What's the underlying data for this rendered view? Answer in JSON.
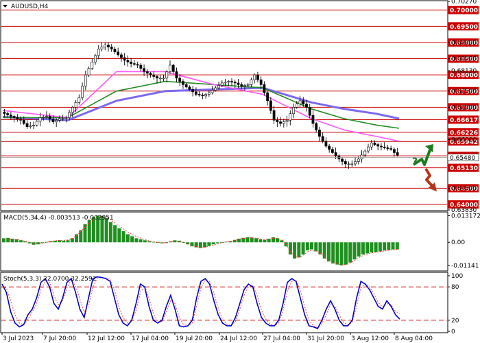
{
  "chart_data": [
    {
      "type": "candlestick",
      "title": "AUDUSD,H4",
      "ylim": [
        0.6383,
        0.7027
      ],
      "price_labels": [
        "0.70270",
        "0.69000",
        "0.68500",
        "0.68130",
        "0.67500",
        "0.67000",
        "0.66000",
        "0.64500",
        "0.63830"
      ],
      "level_lines": [
        {
          "value": 0.7,
          "label": "0.70000",
          "color": "#cc0000"
        },
        {
          "value": 0.695,
          "label": "0.69500",
          "color": "#cc0000"
        },
        {
          "value": 0.69,
          "label": "0.69000",
          "color": "#cc0000"
        },
        {
          "value": 0.685,
          "label": "0.68500",
          "color": "#cc0000"
        },
        {
          "value": 0.68,
          "label": "0.68000",
          "color": "#cc0000"
        },
        {
          "value": 0.675,
          "label": "0.67500",
          "color": "#cc0000"
        },
        {
          "value": 0.67,
          "label": "0.67000",
          "color": "#cc0000"
        },
        {
          "value": 0.66617,
          "label": "0.66617",
          "color": "#cc0000"
        },
        {
          "value": 0.66226,
          "label": "0.66226",
          "color": "#cc0000"
        },
        {
          "value": 0.65942,
          "label": "0.65942",
          "color": "#cc0000"
        },
        {
          "value": 0.655,
          "label": "0.65500",
          "color": "#cc0000"
        },
        {
          "value": 0.6513,
          "label": "0.65130",
          "color": "#cc0000"
        },
        {
          "value": 0.645,
          "label": "0.64500",
          "color": "#cc0000"
        },
        {
          "value": 0.64,
          "label": "0.64000",
          "color": "#cc0000"
        }
      ],
      "current_price": {
        "value": 0.6545,
        "label": "0.65480"
      },
      "annotation": "?",
      "x_tick_labels": [
        "3 Jul 2023",
        "7 Jul 20:00",
        "12 Jul 12:00",
        "17 Jul 04:00",
        "19 Jul 20:00",
        "24 Jul 12:00",
        "27 Jul 04:00",
        "31 Jul 20:00",
        "3 Aug 12:00",
        "8 Aug 04:00"
      ],
      "price_path": [
        [
          0,
          0.6685
        ],
        [
          3,
          0.6672
        ],
        [
          6,
          0.666
        ],
        [
          8,
          0.664
        ],
        [
          10,
          0.6645
        ],
        [
          12,
          0.6668
        ],
        [
          14,
          0.6672
        ],
        [
          16,
          0.6655
        ],
        [
          18,
          0.6665
        ],
        [
          20,
          0.6668
        ],
        [
          22,
          0.67
        ],
        [
          24,
          0.673
        ],
        [
          26,
          0.68
        ],
        [
          28,
          0.684
        ],
        [
          30,
          0.688
        ],
        [
          32,
          0.6892
        ],
        [
          34,
          0.688
        ],
        [
          36,
          0.6862
        ],
        [
          38,
          0.6845
        ],
        [
          40,
          0.6835
        ],
        [
          42,
          0.683
        ],
        [
          44,
          0.681
        ],
        [
          46,
          0.68
        ],
        [
          48,
          0.679
        ],
        [
          50,
          0.679
        ],
        [
          52,
          0.683
        ],
        [
          54,
          0.679
        ],
        [
          56,
          0.677
        ],
        [
          58,
          0.6755
        ],
        [
          60,
          0.674
        ],
        [
          62,
          0.6735
        ],
        [
          64,
          0.6745
        ],
        [
          66,
          0.676
        ],
        [
          68,
          0.6775
        ],
        [
          70,
          0.678
        ],
        [
          72,
          0.6775
        ],
        [
          74,
          0.6765
        ],
        [
          76,
          0.677
        ],
        [
          78,
          0.68
        ],
        [
          80,
          0.677
        ],
        [
          82,
          0.672
        ],
        [
          84,
          0.666
        ],
        [
          86,
          0.665
        ],
        [
          88,
          0.666
        ],
        [
          90,
          0.67
        ],
        [
          92,
          0.672
        ],
        [
          94,
          0.67
        ],
        [
          96,
          0.665
        ],
        [
          98,
          0.661
        ],
        [
          100,
          0.658
        ],
        [
          102,
          0.656
        ],
        [
          104,
          0.654
        ],
        [
          106,
          0.6525
        ],
        [
          108,
          0.6525
        ],
        [
          110,
          0.654
        ],
        [
          112,
          0.6565
        ],
        [
          114,
          0.659
        ],
        [
          116,
          0.658
        ],
        [
          118,
          0.6575
        ],
        [
          120,
          0.657
        ],
        [
          121,
          0.656
        ],
        [
          122,
          0.6552
        ]
      ],
      "series": [
        {
          "name": "",
          "color": "#7b68ee",
          "values": [
            [
              0,
              0.667
            ],
            [
              20,
              0.666
            ],
            [
              35,
              0.672
            ],
            [
              50,
              0.675
            ],
            [
              65,
              0.6755
            ],
            [
              80,
              0.676
            ],
            [
              95,
              0.6715
            ],
            [
              105,
              0.6695
            ],
            [
              115,
              0.668
            ],
            [
              122,
              0.6665
            ]
          ]
        },
        {
          "name": "",
          "color": "#228b22",
          "values": [
            [
              0,
              0.6668
            ],
            [
              20,
              0.6668
            ],
            [
              35,
              0.675
            ],
            [
              50,
              0.678
            ],
            [
              65,
              0.677
            ],
            [
              80,
              0.676
            ],
            [
              95,
              0.6695
            ],
            [
              105,
              0.6665
            ],
            [
              115,
              0.6645
            ],
            [
              122,
              0.6635
            ]
          ]
        },
        {
          "name": "",
          "color": "#ff55ff",
          "values": [
            [
              0,
              0.669
            ],
            [
              20,
              0.6668
            ],
            [
              35,
              0.681
            ],
            [
              50,
              0.681
            ],
            [
              65,
              0.677
            ],
            [
              80,
              0.674
            ],
            [
              95,
              0.6665
            ],
            [
              105,
              0.663
            ],
            [
              115,
              0.661
            ],
            [
              122,
              0.6595
            ]
          ]
        }
      ]
    },
    {
      "type": "histogram",
      "title": "MACD(5,34,4) -0.003513 -0.002951",
      "ylim": [
        -0.0135,
        0.014
      ],
      "y_tick_labels": [
        "0.013172",
        "0.00",
        "-0.01141"
      ],
      "values": [
        0.002,
        0.0022,
        0.0018,
        0.0015,
        0.001,
        0.0005,
        -0.0005,
        -0.0012,
        -0.001,
        -0.0004,
        0.0002,
        0.0006,
        0.0008,
        0.001,
        0.0008,
        0.001,
        0.002,
        0.004,
        0.006,
        0.009,
        0.011,
        0.0125,
        0.0132,
        0.013,
        0.012,
        0.01,
        0.0085,
        0.007,
        0.0055,
        0.004,
        0.003,
        0.002,
        0.0015,
        0.001,
        0.0005,
        0.0002,
        -0.0002,
        -0.0005,
        -0.0004,
        0.0005,
        0.001,
        0.0008,
        -0.0002,
        -0.001,
        -0.002,
        -0.0025,
        -0.0028,
        -0.0025,
        -0.0018,
        -0.001,
        -0.0004,
        0.0,
        0.0003,
        0.0006,
        0.0012,
        0.0018,
        0.0022,
        0.0025,
        0.0024,
        0.002,
        0.0015,
        0.0012,
        0.0018,
        0.0025,
        0.002,
        0.001,
        -0.002,
        -0.006,
        -0.008,
        -0.0075,
        -0.006,
        -0.004,
        -0.0035,
        -0.0045,
        -0.006,
        -0.008,
        -0.0095,
        -0.0105,
        -0.011,
        -0.0114,
        -0.011,
        -0.01,
        -0.0085,
        -0.007,
        -0.006,
        -0.0055,
        -0.005,
        -0.0048,
        -0.0045,
        -0.004,
        -0.0038,
        -0.0035,
        -0.0035
      ],
      "signal": [
        0.0015,
        0.0016,
        0.0016,
        0.0014,
        0.001,
        0.0005,
        0.0,
        -0.0005,
        -0.0007,
        -0.0004,
        0.0,
        0.0005,
        0.0008,
        0.001,
        0.001,
        0.0012,
        0.002,
        0.0035,
        0.0055,
        0.0078,
        0.0098,
        0.0115,
        0.0125,
        0.0128,
        0.0124,
        0.011,
        0.0095,
        0.008,
        0.0065,
        0.005,
        0.0038,
        0.0028,
        0.002,
        0.0013,
        0.0007,
        0.0003,
        -0.0001,
        -0.0003,
        -0.0002,
        0.0003,
        0.0007,
        0.0006,
        0.0,
        -0.0008,
        -0.0016,
        -0.0022,
        -0.0025,
        -0.0024,
        -0.0019,
        -0.0012,
        -0.0006,
        -0.0002,
        0.0002,
        0.0005,
        0.001,
        0.0015,
        0.0019,
        0.0022,
        0.0022,
        0.002,
        0.0017,
        0.0014,
        0.0016,
        0.0021,
        0.0019,
        0.0012,
        -0.0012,
        -0.0048,
        -0.0072,
        -0.0074,
        -0.0063,
        -0.0046,
        -0.0039,
        -0.0043,
        -0.0055,
        -0.0073,
        -0.0089,
        -0.01,
        -0.0107,
        -0.0112,
        -0.011,
        -0.0102,
        -0.0089,
        -0.0075,
        -0.0064,
        -0.0057,
        -0.0052,
        -0.0049,
        -0.0046,
        -0.0042,
        -0.0039,
        -0.0036,
        -0.0035
      ]
    },
    {
      "type": "line",
      "title": "Stoch(5,3,3) 22.0700 32.2592",
      "ylim": [
        0,
        100
      ],
      "y_tick_labels": [
        "100",
        "80",
        "20",
        "0"
      ],
      "levels": [
        80,
        20
      ],
      "series": [
        {
          "name": "",
          "color": "#0000cc",
          "values": [
            85,
            70,
            35,
            15,
            8,
            12,
            30,
            40,
            60,
            88,
            95,
            80,
            50,
            40,
            60,
            88,
            95,
            70,
            40,
            25,
            60,
            95,
            98,
            97,
            95,
            90,
            60,
            30,
            15,
            10,
            20,
            50,
            85,
            80,
            45,
            20,
            15,
            20,
            45,
            65,
            40,
            10,
            8,
            10,
            20,
            60,
            90,
            95,
            85,
            55,
            30,
            15,
            10,
            10,
            25,
            50,
            75,
            85,
            80,
            50,
            25,
            15,
            10,
            10,
            20,
            50,
            88,
            95,
            90,
            60,
            30,
            10,
            8,
            5,
            20,
            40,
            55,
            40,
            20,
            10,
            10,
            20,
            60,
            90,
            85,
            75,
            60,
            45,
            40,
            55,
            45,
            30,
            22
          ]
        },
        {
          "name": "",
          "color": "#ff3333",
          "values": [
            80,
            78,
            55,
            30,
            15,
            12,
            22,
            35,
            50,
            75,
            90,
            88,
            65,
            48,
            55,
            78,
            92,
            82,
            58,
            35,
            45,
            80,
            95,
            97,
            96,
            93,
            75,
            45,
            25,
            15,
            18,
            38,
            70,
            82,
            60,
            32,
            18,
            18,
            35,
            55,
            50,
            25,
            12,
            10,
            15,
            45,
            78,
            92,
            90,
            70,
            42,
            22,
            13,
            10,
            18,
            40,
            65,
            80,
            82,
            65,
            38,
            22,
            13,
            10,
            15,
            38,
            72,
            90,
            92,
            75,
            45,
            20,
            10,
            7,
            14,
            30,
            48,
            45,
            30,
            16,
            12,
            16,
            45,
            78,
            86,
            80,
            68,
            52,
            44,
            50,
            48,
            36,
            32
          ]
        }
      ]
    }
  ]
}
